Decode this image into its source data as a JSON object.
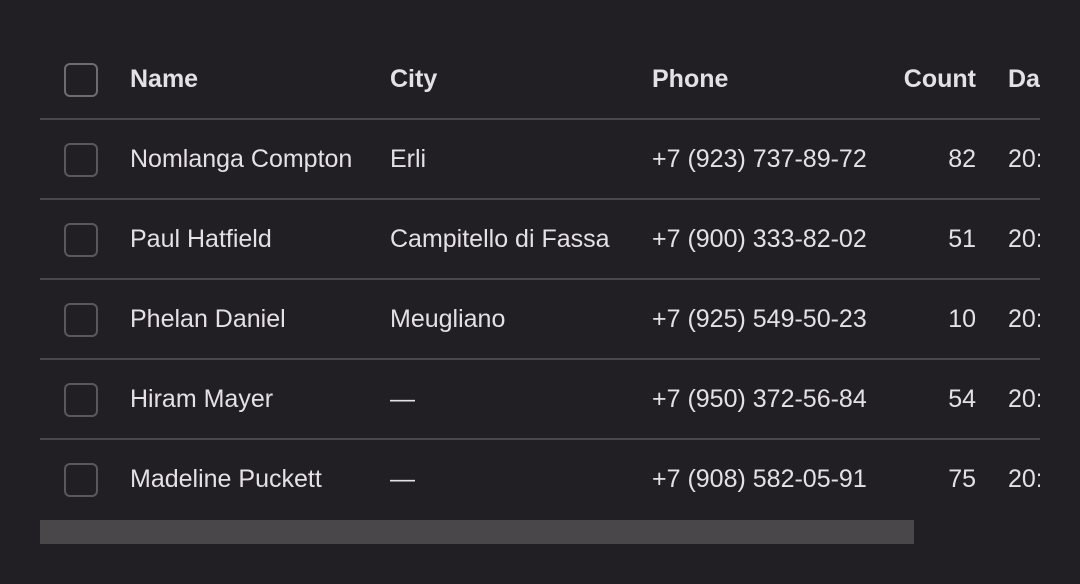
{
  "table": {
    "columns": {
      "name": "Name",
      "city": "City",
      "phone": "Phone",
      "count": "Count",
      "date": "Da"
    },
    "rows": [
      {
        "name": "Nomlanga Compton",
        "city": "Erli",
        "phone": "+7 (923) 737-89-72",
        "count": "82",
        "date": "20:"
      },
      {
        "name": "Paul Hatfield",
        "city": "Campitello di Fassa",
        "phone": "+7 (900) 333-82-02",
        "count": "51",
        "date": "20:"
      },
      {
        "name": "Phelan Daniel",
        "city": "Meugliano",
        "phone": "+7 (925) 549-50-23",
        "count": "10",
        "date": "20:"
      },
      {
        "name": "Hiram Mayer",
        "city": "—",
        "phone": "+7 (950) 372-56-84",
        "count": "54",
        "date": "20:"
      },
      {
        "name": "Madeline Puckett",
        "city": "—",
        "phone": "+7 (908) 582-05-91",
        "count": "75",
        "date": "20:"
      }
    ]
  },
  "scrollbar": {
    "visible_fraction": 0.874,
    "position": 0
  },
  "colors": {
    "background": "#221f24",
    "text": "#e3e0e6",
    "divider": "#4a474d",
    "scroll_thumb": "#4a474b"
  }
}
